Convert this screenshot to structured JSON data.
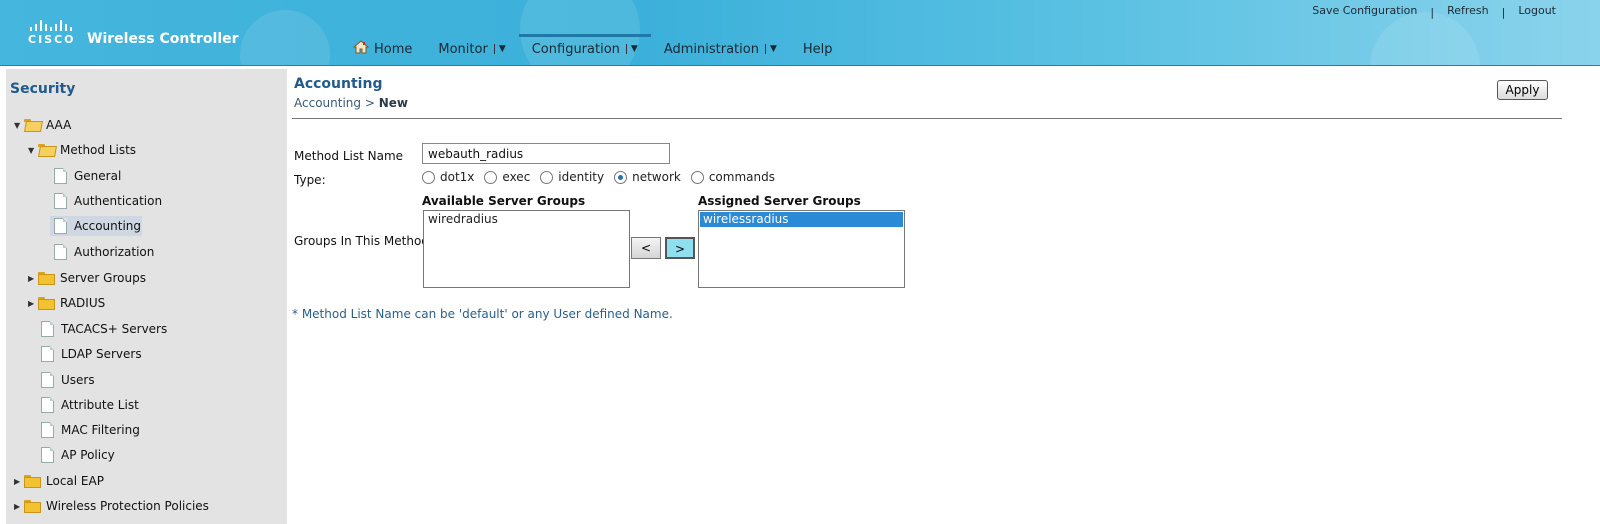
{
  "header": {
    "logo_text": "CISCO",
    "product_title": "Wireless Controller",
    "links": [
      "Save Configuration",
      "Refresh",
      "Logout"
    ],
    "link_separator": "|",
    "nav": [
      {
        "label": "Home",
        "icon": "home-icon",
        "dropdown": false
      },
      {
        "label": "Monitor",
        "dropdown": true
      },
      {
        "label": "Configuration",
        "dropdown": true,
        "active": true
      },
      {
        "label": "Administration",
        "dropdown": true
      },
      {
        "label": "Help",
        "dropdown": false
      }
    ],
    "dropdown_caret": "▼"
  },
  "sidebar": {
    "title": "Security",
    "items": [
      {
        "label": "AAA",
        "type": "folder-open",
        "expanded": true
      },
      {
        "label": "Method Lists",
        "type": "folder-open",
        "expanded": true
      },
      {
        "label": "General",
        "type": "page"
      },
      {
        "label": "Authentication",
        "type": "page"
      },
      {
        "label": "Accounting",
        "type": "page",
        "selected": true
      },
      {
        "label": "Authorization",
        "type": "page"
      },
      {
        "label": "Server Groups",
        "type": "folder",
        "expanded": false
      },
      {
        "label": "RADIUS",
        "type": "folder",
        "expanded": false
      },
      {
        "label": "TACACS+ Servers",
        "type": "page"
      },
      {
        "label": "LDAP Servers",
        "type": "page"
      },
      {
        "label": "Users",
        "type": "page"
      },
      {
        "label": "Attribute List",
        "type": "page"
      },
      {
        "label": "MAC Filtering",
        "type": "page"
      },
      {
        "label": "AP Policy",
        "type": "page"
      },
      {
        "label": "Local EAP",
        "type": "folder",
        "expanded": false
      },
      {
        "label": "Wireless Protection Policies",
        "type": "folder",
        "expanded": false
      }
    ]
  },
  "main": {
    "title": "Accounting",
    "breadcrumb": {
      "parent": "Accounting",
      "separator": ">",
      "current": "New"
    },
    "apply_label": "Apply",
    "form": {
      "method_list_name_label": "Method List Name",
      "method_list_name_value": "webauth_radius",
      "type_label": "Type:",
      "type_options": [
        "dot1x",
        "exec",
        "identity",
        "network",
        "commands"
      ],
      "type_selected": "network",
      "groups_label": "Groups In This Method",
      "available_title": "Available Server Groups",
      "available_groups": [
        "wiredradius"
      ],
      "assigned_title": "Assigned Server Groups",
      "assigned_groups": [
        "wirelessradius"
      ],
      "assigned_selected": "wirelessradius",
      "move_left_label": "<",
      "move_right_label": ">"
    },
    "note": "* Method List Name can be 'default' or any User defined Name."
  },
  "colors": {
    "header_blue": "#45b6dd",
    "title_blue": "#215a8c",
    "sidebar_bg": "#e3e3e3",
    "selection_blue": "#2a8ad6"
  }
}
